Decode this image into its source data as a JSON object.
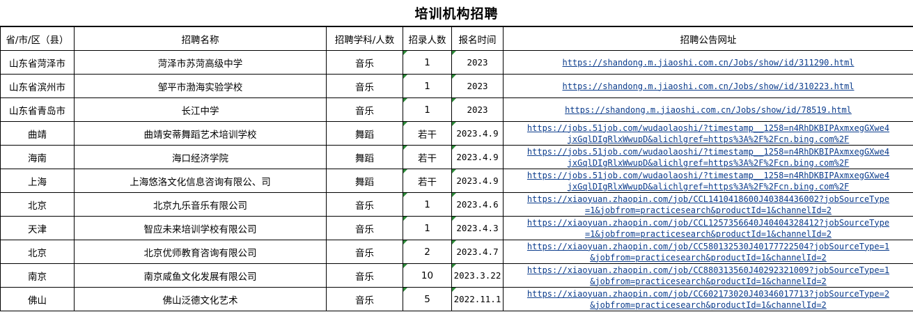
{
  "sheet_title": "培训机构招聘",
  "headers": [
    "省/市/区（县）",
    "招聘名称",
    "招聘学科/人数",
    "招录人数",
    "报名时间",
    "招聘公告网址"
  ],
  "rows": [
    {
      "region": "山东省菏泽市",
      "name": "菏泽市苏菏高级中学",
      "subject": "音乐",
      "count": "1",
      "date": "2023",
      "url_line1": "https://shandong.m.jiaoshi.com.cn/Jobs/show/id/311290.html",
      "url_line2": ""
    },
    {
      "region": "山东省滨州市",
      "name": "邹平市渤海实验学校",
      "subject": "音乐",
      "count": "1",
      "date": "2023",
      "url_line1": "https://shandong.m.jiaoshi.com.cn/Jobs/show/id/310223.html",
      "url_line2": ""
    },
    {
      "region": "山东省青岛市",
      "name": "长江中学",
      "subject": "音乐",
      "count": "1",
      "date": "2023",
      "url_line1": "https://shandong.m.jiaoshi.com.cn/Jobs/show/id/78519.html",
      "url_line2": ""
    },
    {
      "region": "曲靖",
      "name": "曲靖安蒂舞蹈艺术培训学校",
      "subject": "舞蹈",
      "count": "若干",
      "date": "2023.4.9",
      "url_line1": "https://jobs.51job.com/wudaolaoshi/?timestamp__1258=n4RhDKBIPAxmxegGXwe4",
      "url_line2": "jxGqlDIgRlxWwupD&alichlgref=https%3A%2F%2Fcn.bing.com%2F"
    },
    {
      "region": "海南",
      "name": "海口经济学院",
      "subject": "舞蹈",
      "count": "若干",
      "date": "2023.4.9",
      "url_line1": "https://jobs.51job.com/wudaolaoshi/?timestamp__1258=n4RhDKBIPAxmxegGXwe4",
      "url_line2": "jxGqlDIgRlxWwupD&alichlgref=https%3A%2F%2Fcn.bing.com%2F"
    },
    {
      "region": "上海",
      "name": "上海悠洛文化信息咨询有限公、司",
      "subject": "舞蹈",
      "count": "若干",
      "date": "2023.4.9",
      "url_line1": "https://jobs.51job.com/wudaolaoshi/?timestamp__1258=n4RhDKBIPAxmxegGXwe4",
      "url_line2": "jxGqlDIgRlxWwupD&alichlgref=https%3A%2F%2Fcn.bing.com%2F"
    },
    {
      "region": "北京",
      "name": "北京九乐音乐有限公司",
      "subject": "音乐",
      "count": "1",
      "date": "2023.4.6",
      "url_line1": "https://xiaoyuan.zhaopin.com/job/CCL1410418600J40384436002?jobSourceType",
      "url_line2": "=1&jobfrom=practicesearch&productId=1&channelId=2"
    },
    {
      "region": "天津",
      "name": "智应未来培训学校有限公司",
      "subject": "音乐",
      "count": "1",
      "date": "2023.4.3",
      "url_line1": "https://xiaoyuan.zhaopin.com/job/CCL1257356640J40404328412?jobSourceType",
      "url_line2": "=1&jobfrom=practicesearch&productId=1&channelId=2"
    },
    {
      "region": "北京",
      "name": "北京优师教育咨询有限公司",
      "subject": "音乐",
      "count": "2",
      "date": "2023.4.7",
      "url_line1": "https://xiaoyuan.zhaopin.com/job/CC580132530J40177722504?jobSourceType=1",
      "url_line2": "&jobfrom=practicesearch&productId=1&channelId=2"
    },
    {
      "region": "南京",
      "name": "南京咸鱼文化发展有限公司",
      "subject": "音乐",
      "count": "10",
      "date": "2023.3.22",
      "url_line1": "https://xiaoyuan.zhaopin.com/job/CC880313560J40292321009?jobSourceType=1",
      "url_line2": "&jobfrom=practicesearch&productId=1&channelId=2"
    },
    {
      "region": "佛山",
      "name": "佛山泛德文化艺术",
      "subject": "音乐",
      "count": "5",
      "date": "2022.11.1",
      "url_line1": "https://xiaoyuan.zhaopin.com/job/CC602173020J40346017713?jobSourceType=2",
      "url_line2": "&jobfrom=practicesearch&productId=1&channelId=2"
    }
  ],
  "colors": {
    "link": "#0b3c8c",
    "comment_marker": "#2e8b3a",
    "grid": "#000000"
  }
}
